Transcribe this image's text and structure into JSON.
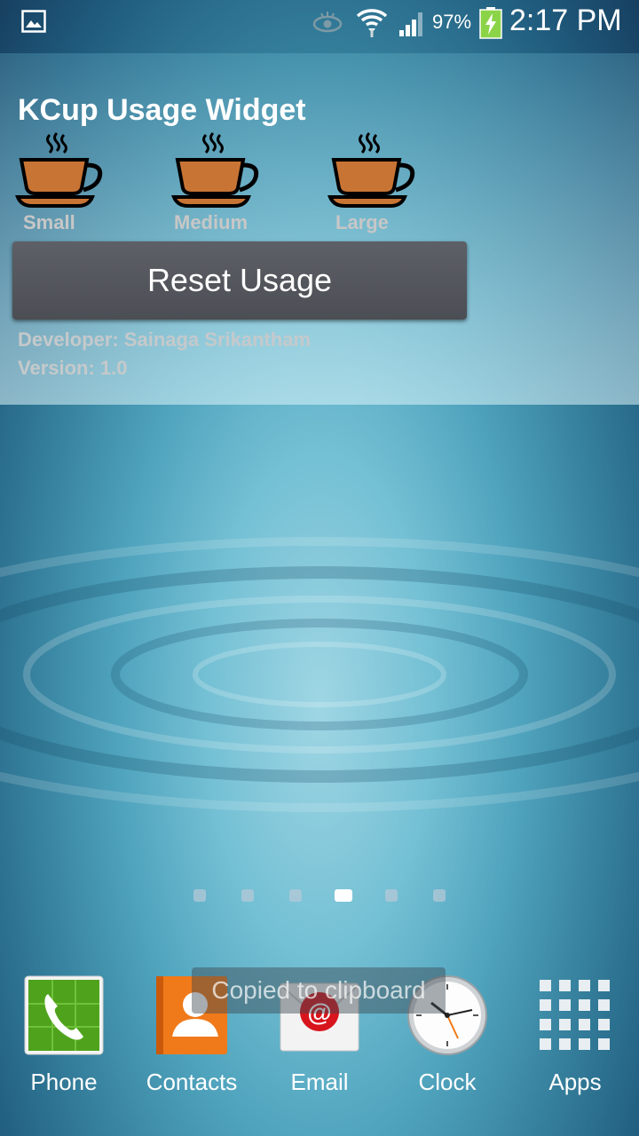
{
  "status_bar": {
    "battery_percent": "97%",
    "time": "2:17 PM"
  },
  "widget": {
    "title": "KCup Usage Widget",
    "cups": [
      {
        "label": "Small"
      },
      {
        "label": "Medium"
      },
      {
        "label": "Large"
      }
    ],
    "reset_button_label": "Reset Usage",
    "developer": "Developer: Sainaga Srikantham",
    "version": "Version: 1.0"
  },
  "page_indicator": {
    "count": 6,
    "active_index": 3
  },
  "dock": {
    "items": [
      {
        "label": "Phone",
        "icon": "phone-icon"
      },
      {
        "label": "Contacts",
        "icon": "contacts-icon"
      },
      {
        "label": "Email",
        "icon": "email-icon"
      },
      {
        "label": "Clock",
        "icon": "clock-icon"
      },
      {
        "label": "Apps",
        "icon": "apps-grid-icon"
      }
    ]
  },
  "toast": {
    "text": "Copied to clipboard"
  },
  "colors": {
    "cup_fill": "#c87434",
    "button_bg": "#52555b",
    "battery_green": "#8bd447"
  }
}
